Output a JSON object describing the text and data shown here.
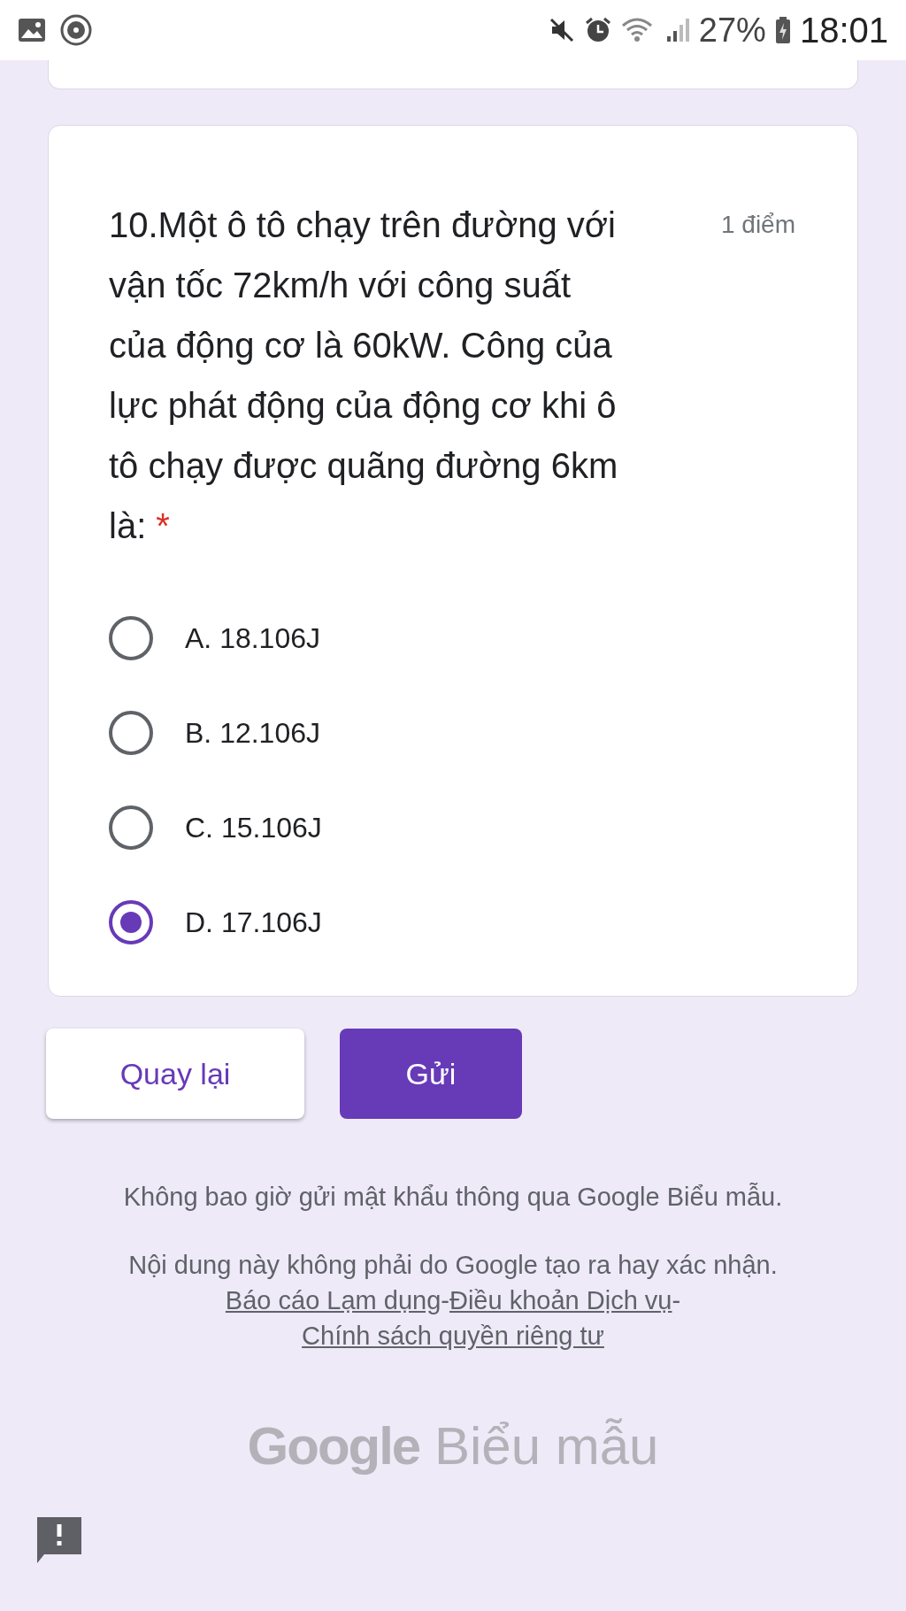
{
  "status_bar": {
    "battery": "27%",
    "time": "18:01"
  },
  "question": {
    "text": "10.Một ô tô chạy trên đường với vận tốc 72km/h với công suất của động cơ là 60kW. Công của lực phát động của động cơ khi ô tô chạy được quãng đường 6km là:",
    "required_mark": "*",
    "points": "1 điểm",
    "options": [
      {
        "label": "A. 18.106J",
        "selected": false
      },
      {
        "label": "B. 12.106J",
        "selected": false
      },
      {
        "label": "C. 15.106J",
        "selected": false
      },
      {
        "label": "D. 17.106J",
        "selected": true
      }
    ]
  },
  "buttons": {
    "back": "Quay lại",
    "submit": "Gửi"
  },
  "footer": {
    "warning": "Không bao giờ gửi mật khẩu thông qua Google Biểu mẫu.",
    "disclaimer": "Nội dung này không phải do Google tạo ra hay xác nhận.",
    "links": [
      "Báo cáo Lạm dụng",
      "Điều khoản Dịch vụ",
      "Chính sách quyền riêng tư"
    ],
    "separator": "-",
    "logo_brand": "Google",
    "logo_product": "Biểu mẫu"
  }
}
